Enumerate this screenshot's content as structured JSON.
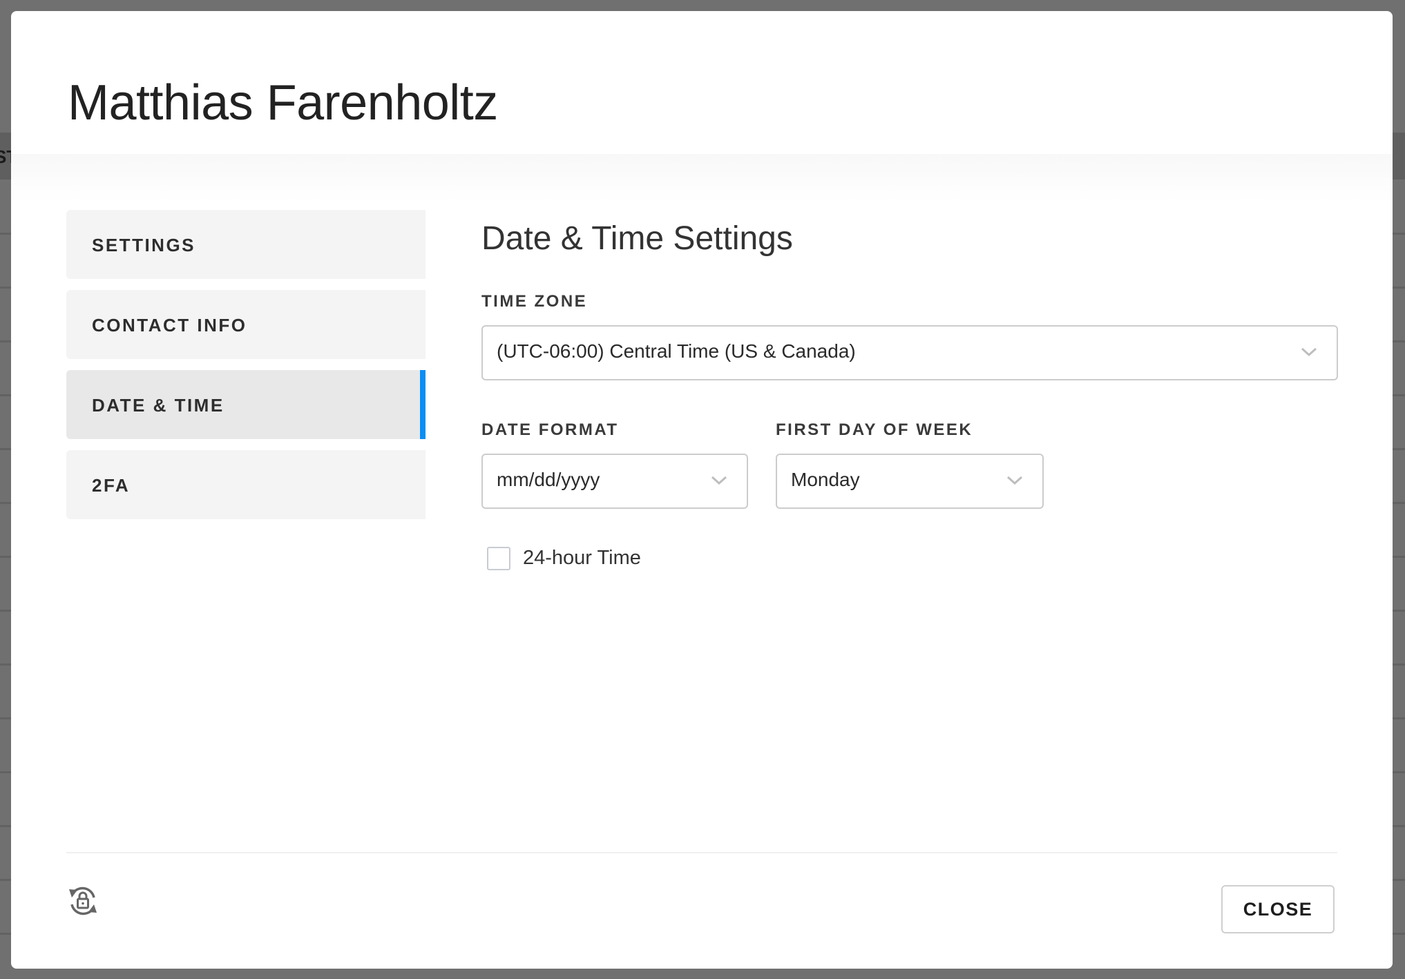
{
  "backdrop": {
    "partial_text": "ST"
  },
  "modal": {
    "title": "Matthias Farenholtz"
  },
  "sidebar": {
    "items": [
      {
        "label": "SETTINGS",
        "active": false
      },
      {
        "label": "CONTACT INFO",
        "active": false
      },
      {
        "label": "DATE & TIME",
        "active": true
      },
      {
        "label": "2FA",
        "active": false
      }
    ]
  },
  "main": {
    "section_title": "Date & Time Settings",
    "time_zone": {
      "label": "TIME ZONE",
      "value": "(UTC-06:00) Central Time (US & Canada)"
    },
    "date_format": {
      "label": "DATE FORMAT",
      "value": "mm/dd/yyyy"
    },
    "first_day_of_week": {
      "label": "FIRST DAY OF WEEK",
      "value": "Monday"
    },
    "hour24": {
      "label": "24-hour Time",
      "checked": false
    }
  },
  "footer": {
    "reset_icon": "lock-reset-icon",
    "close_label": "CLOSE"
  },
  "colors": {
    "accent": "#0a8ef5",
    "sidebar_bg": "#f4f4f4",
    "sidebar_active_bg": "#e8e8e8",
    "backdrop": "#707070"
  }
}
